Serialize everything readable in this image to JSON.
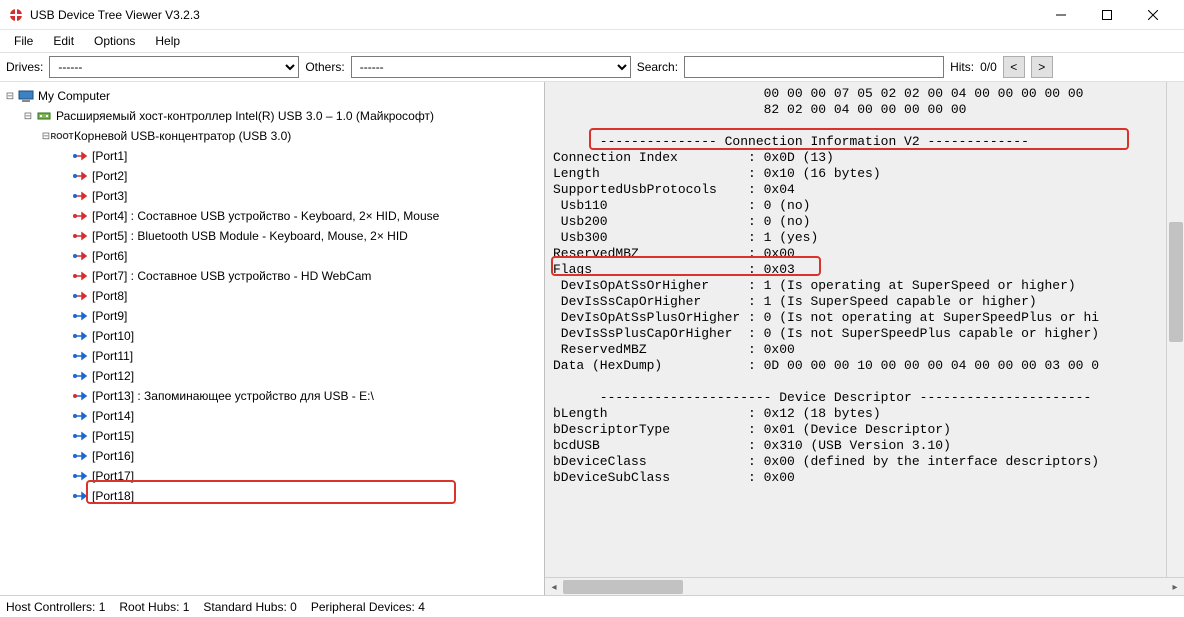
{
  "window": {
    "title": "USB Device Tree Viewer V3.2.3"
  },
  "menubar": [
    "File",
    "Edit",
    "Options",
    "Help"
  ],
  "toolbar": {
    "drives_label": "Drives:",
    "drives_value": "------",
    "others_label": "Others:",
    "others_value": "------",
    "search_label": "Search:",
    "search_value": "",
    "hits_label": "Hits:",
    "hits_value": "0/0",
    "prev": "<",
    "next": ">"
  },
  "tree": {
    "root": "My Computer",
    "controller": "Расширяемый хост-контроллер Intel(R) USB 3.0 – 1.0 (Майкрософт)",
    "hub": "Корневой USB-концентратор (USB 3.0)",
    "ports": [
      "[Port1]",
      "[Port2]",
      "[Port3]",
      "[Port4] : Составное USB устройство - Keyboard, 2× HID, Mouse",
      "[Port5] : Bluetooth USB Module - Keyboard, Mouse, 2× HID",
      "[Port6]",
      "[Port7] : Составное USB устройство - HD WebCam",
      "[Port8]",
      "[Port9]",
      "[Port10]",
      "[Port11]",
      "[Port12]",
      "[Port13] : Запоминающее устройство для USB - E:\\",
      "[Port14]",
      "[Port15]",
      "[Port16]",
      "[Port17]",
      "[Port18]"
    ]
  },
  "details": {
    "lines": [
      "                           00 00 00 07 05 02 02 00 04 00 00 00 00 00",
      "                           82 02 00 04 00 00 00 00 00",
      "",
      "      --------------- Connection Information V2 -------------",
      "Connection Index         : 0x0D (13)",
      "Length                   : 0x10 (16 bytes)",
      "SupportedUsbProtocols    : 0x04",
      " Usb110                  : 0 (no)",
      " Usb200                  : 0 (no)",
      " Usb300                  : 1 (yes)",
      "ReservedMBZ              : 0x00",
      "Flags                    : 0x03",
      " DevIsOpAtSsOrHigher     : 1 (Is operating at SuperSpeed or higher)",
      " DevIsSsCapOrHigher      : 1 (Is SuperSpeed capable or higher)",
      " DevIsOpAtSsPlusOrHigher : 0 (Is not operating at SuperSpeedPlus or hi",
      " DevIsSsPlusCapOrHigher  : 0 (Is not SuperSpeedPlus capable or higher)",
      " ReservedMBZ             : 0x00",
      "Data (HexDump)           : 0D 00 00 00 10 00 00 00 04 00 00 00 03 00 0",
      "",
      "      ---------------------- Device Descriptor ----------------------",
      "bLength                  : 0x12 (18 bytes)",
      "bDescriptorType          : 0x01 (Device Descriptor)",
      "bcdUSB                   : 0x310 (USB Version 3.10)",
      "bDeviceClass             : 0x00 (defined by the interface descriptors)",
      "bDeviceSubClass          : 0x00"
    ]
  },
  "status": {
    "host_controllers": "Host Controllers: 1",
    "root_hubs": "Root Hubs: 1",
    "std_hubs": "Standard Hubs: 0",
    "peripheral": "Peripheral Devices: 4"
  }
}
